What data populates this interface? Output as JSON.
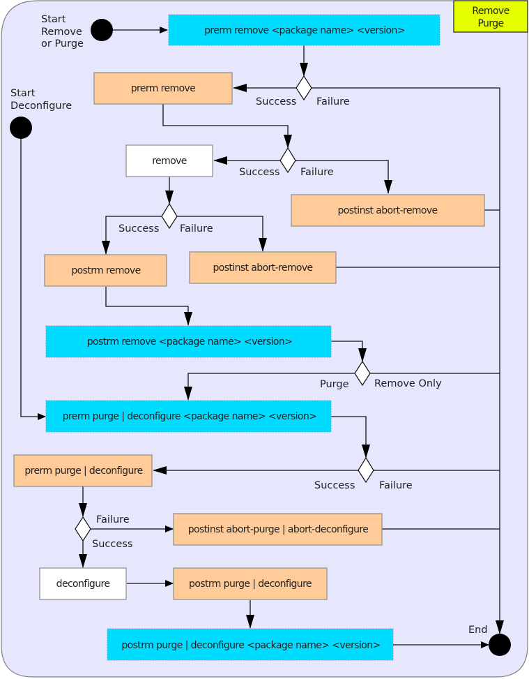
{
  "diagram": {
    "title": "Remove Purge",
    "title_lines": [
      "Remove",
      "Purge"
    ],
    "colors": {
      "background": "#e6e6fc",
      "maintainer_script_call": "#00dcff",
      "error_unwind": "#ffcc99",
      "action": "#ffffff",
      "title_box": "#e6ff00"
    },
    "start_nodes": {
      "remove_or_purge": {
        "lines": [
          "Start",
          "Remove",
          "or Purge"
        ]
      },
      "deconfigure": {
        "lines": [
          "Start",
          "Deconfigure"
        ]
      }
    },
    "end_node": {
      "label": "End"
    },
    "nodes": {
      "prerm_remove_call": "prerm remove <package name> <version>",
      "prerm_remove": "prerm remove",
      "remove": "remove",
      "postinst_abort_remove_1": "postinst abort-remove",
      "postinst_abort_remove_2": "postinst abort-remove",
      "postrm_remove": "postrm remove",
      "postrm_remove_call": "postrm remove <package name> <version>",
      "prerm_purge_call": "prerm purge | deconfigure <package name> <version>",
      "prerm_purge": "prerm purge | deconfigure",
      "postinst_abort_purge": "postinst abort-purge | abort-deconfigure",
      "deconfigure": "deconfigure",
      "postrm_purge": "postrm purge | deconfigure",
      "postrm_purge_call": "postrm purge | deconfigure <package name> <version>"
    },
    "edge_labels": {
      "d1_success": "Success",
      "d1_failure": "Failure",
      "d2_success": "Success",
      "d2_failure": "Failure",
      "d3_success": "Success",
      "d3_failure": "Failure",
      "d4_purge": "Purge",
      "d4_remove_only": "Remove Only",
      "d5_success": "Success",
      "d5_failure": "Failure",
      "d6_failure": "Failure",
      "d6_success": "Success"
    }
  }
}
